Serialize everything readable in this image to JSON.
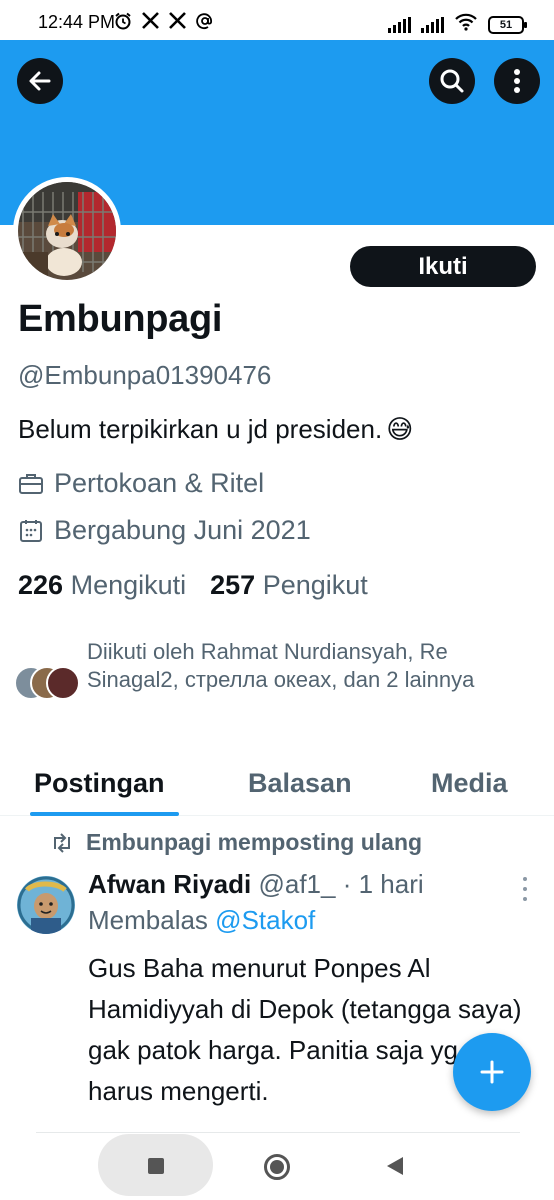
{
  "status_bar": {
    "time": "12:44 PM",
    "notification_icons": [
      "alarm-icon",
      "x-icon",
      "x-icon",
      "at-icon"
    ],
    "battery": "51"
  },
  "profile": {
    "follow_label": "Ikuti",
    "name": "Embunpagi",
    "handle": "@Embunpa01390476",
    "bio": "Belum terpikirkan u jd presiden.",
    "bio_emoji": "😅",
    "category": "Pertokoan & Ritel",
    "joined": "Bergabung Juni 2021",
    "following_count": "226",
    "following_label": "Mengikuti",
    "followers_count": "257",
    "followers_label": "Pengikut",
    "followed_by": "Diikuti oleh Rahmat Nurdiansyah, Re Sinagal2, стрелла океах, dan 2 lainnya"
  },
  "tabs": [
    {
      "label": "Postingan",
      "active": true
    },
    {
      "label": "Balasan",
      "active": false
    },
    {
      "label": "Media",
      "active": false
    }
  ],
  "post": {
    "repost_text": "Embunpagi memposting ulang",
    "author_name": "Afwan Riyadi",
    "author_handle": "@af1_",
    "time": "· 1 hari",
    "reply_prefix": "Membalas",
    "reply_to": "@Stakof",
    "body": "Gus Baha menurut Ponpes Al Hamidiyyah di Depok (tetangga saya) gak patok harga. Panitia saja yg harus mengerti."
  },
  "colors": {
    "banner": "#1d9bf0",
    "accent": "#1d9bf0",
    "text_primary": "#0f1419",
    "text_secondary": "#536471"
  }
}
